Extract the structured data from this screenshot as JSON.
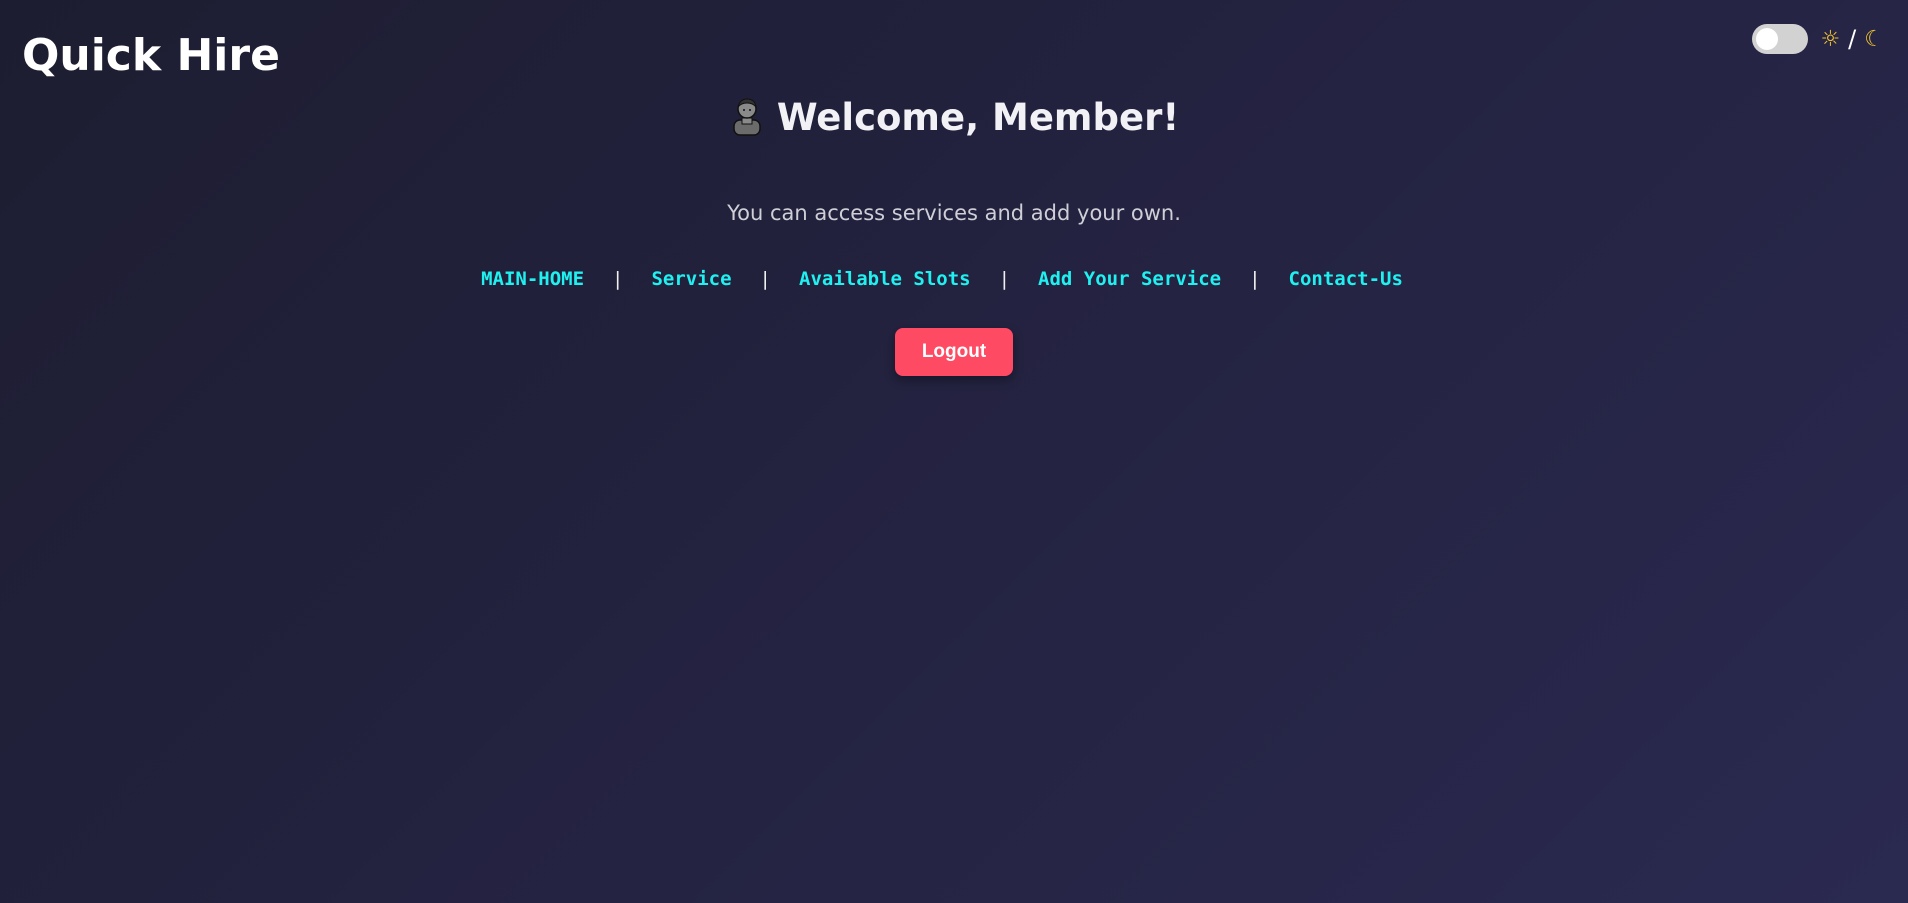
{
  "brand": {
    "title": "Quick Hire"
  },
  "theme_switch": {
    "light_icon": "sun-icon",
    "separator": "/",
    "dark_icon": "moon-icon"
  },
  "welcome": {
    "icon": "person-icon",
    "heading": "Welcome, Member!"
  },
  "subtitle": "You can access services and add your own.",
  "nav": {
    "items": [
      {
        "label": "MAIN-HOME"
      },
      {
        "label": "Service"
      },
      {
        "label": "Available Slots"
      },
      {
        "label": "Add Your Service"
      },
      {
        "label": "Contact-Us"
      }
    ],
    "separator": "|"
  },
  "logout": {
    "label": "Logout"
  },
  "colors": {
    "background_start": "#1d1d31",
    "background_end": "#2a2950",
    "nav_link": "#1ff0f0",
    "logout_button": "#ff4a63",
    "toggle_track": "#d2d2d2"
  }
}
